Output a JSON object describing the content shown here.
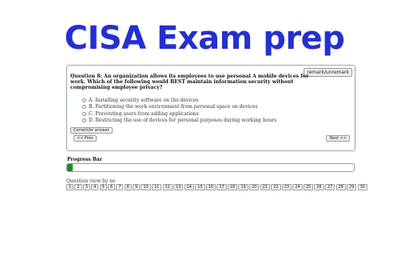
{
  "header": {
    "title": "CISA Exam prep"
  },
  "question": {
    "text": "Question 8: An organization allows its employees to use personal A mobile devices for work. Which of the following would BEST maintain information security without compromising employee privacy?",
    "mark_label": "remark/unremark",
    "options": [
      {
        "label": "A. Installing security software on the devices"
      },
      {
        "label": "B. Partitioning the work environment from personal space on devices"
      },
      {
        "label": "C. Preventing users from adding applications"
      },
      {
        "label": "D. Restricting the use of devices for personal purposes during working hours"
      }
    ],
    "correct_label": "Correct/er answer",
    "prev_label": "<< Prev",
    "next_label": "Next >>"
  },
  "progress": {
    "label": "Progress Bar",
    "value_fraction": 0.02,
    "fill_color": "#1e8a2e"
  },
  "question_view": {
    "label": "Question view by no",
    "numbers": [
      "1",
      "2",
      "3",
      "4",
      "5",
      "6",
      "7",
      "8",
      "9",
      "10",
      "11",
      "12",
      "13",
      "14",
      "15",
      "16",
      "17",
      "18",
      "19",
      "20",
      "21",
      "22",
      "23",
      "24",
      "25",
      "26",
      "27",
      "28",
      "29",
      "30"
    ]
  },
  "colors": {
    "title": "#2430d0",
    "border": "#9aa3b5"
  }
}
